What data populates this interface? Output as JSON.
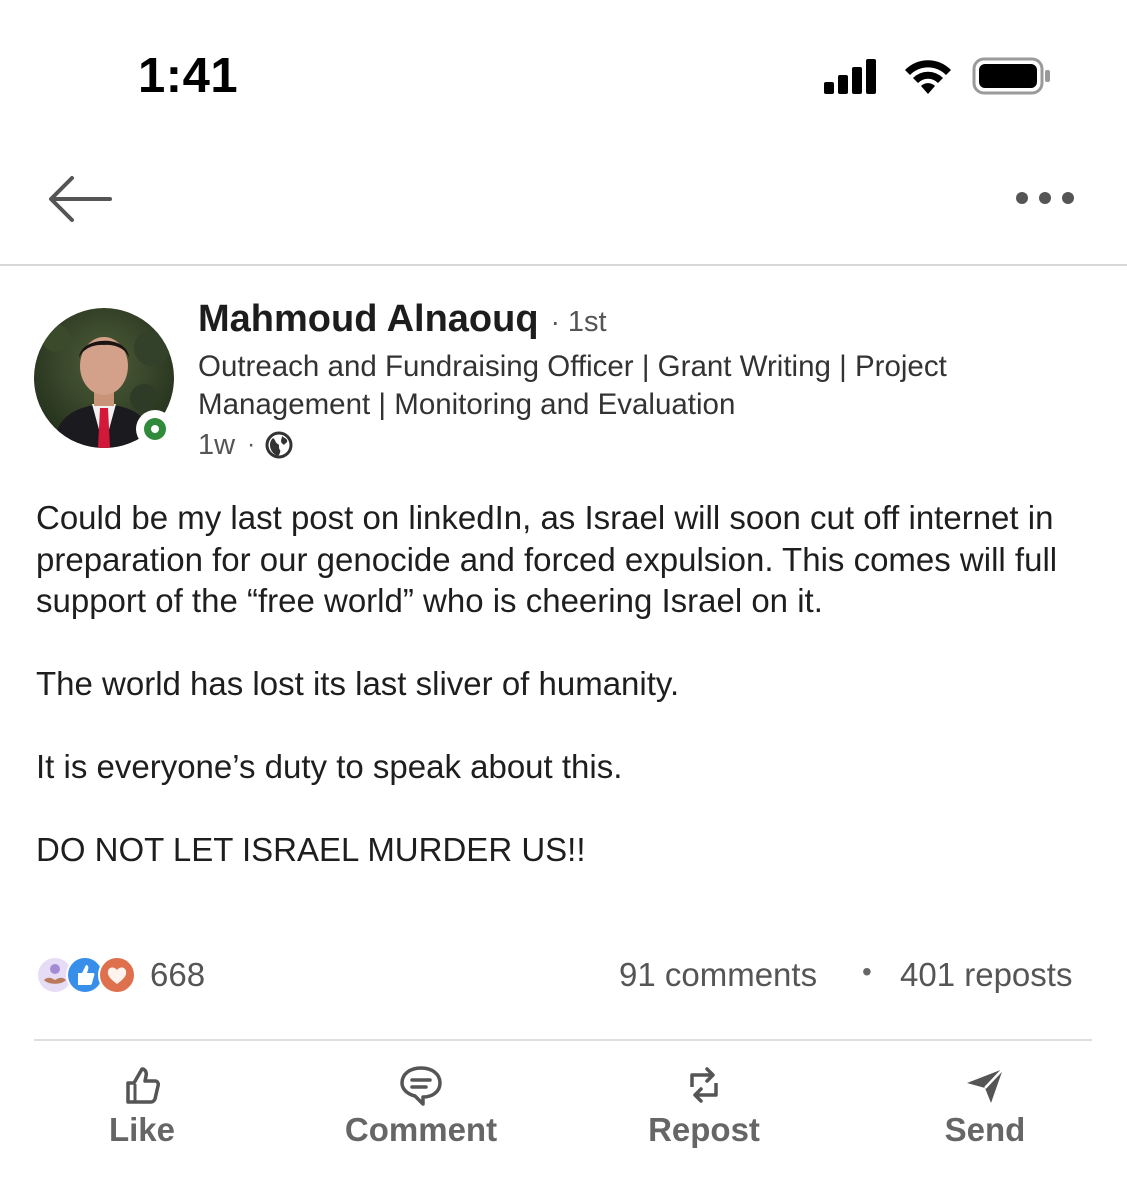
{
  "status_bar": {
    "time": "1:41"
  },
  "nav": {
    "back_icon": "arrow-left-icon",
    "more_icon": "more-horizontal-icon"
  },
  "author": {
    "name": "Mahmoud Alnaouq",
    "dot": "·",
    "degree": "1st",
    "headline": "Outreach and Fundraising Officer | Grant Writing | Project Management | Monitoring and Evaluation",
    "age": "1w",
    "visibility_icon": "globe-icon",
    "online_status_color": "#2f8a3a"
  },
  "post": {
    "paragraphs": [
      "Could be my last post on linkedIn, as Israel will soon cut off internet in preparation for our genocide and forced expulsion. This comes will full support of the “free world” who is cheering Israel on it.",
      "The world has lost its last sliver of humanity.",
      "It is everyone’s duty to speak about this.",
      "DO NOT LET ISRAEL MURDER US!!"
    ]
  },
  "social": {
    "reaction_icons": [
      "support-reaction-icon",
      "like-reaction-icon",
      "love-reaction-icon"
    ],
    "reactions_count": "668",
    "comments": "91 comments",
    "separator": "•",
    "reposts": "401 reposts"
  },
  "actions": {
    "like": "Like",
    "comment": "Comment",
    "repost": "Repost",
    "send": "Send"
  },
  "colors": {
    "text_primary": "#1e1e1e",
    "text_secondary": "#555555",
    "action_gray": "#666666",
    "like_blue": "#378fe9",
    "love_red": "#df704d",
    "support_purple": "#a38bd4"
  }
}
